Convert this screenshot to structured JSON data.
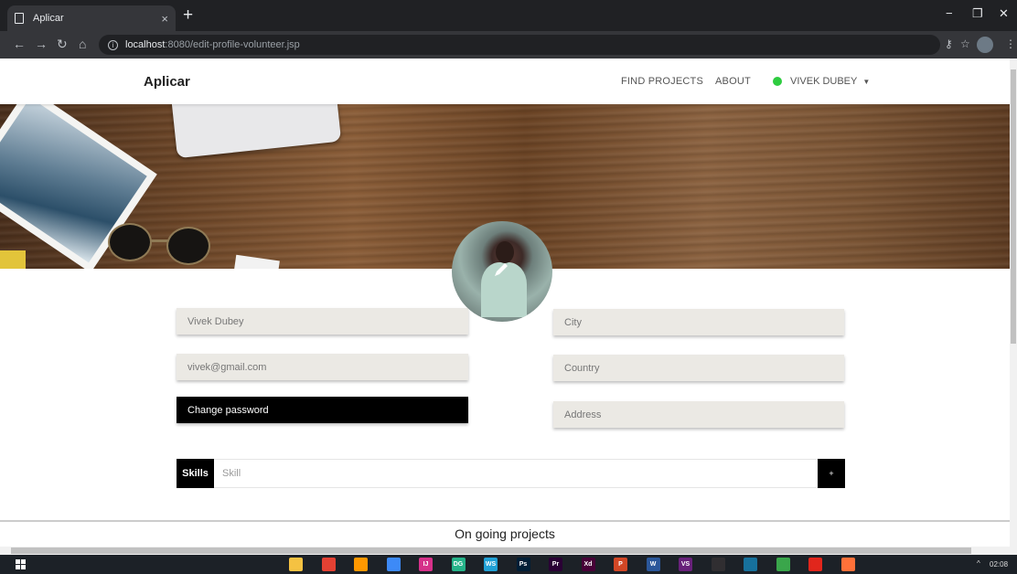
{
  "browser": {
    "tab_title": "Aplicar",
    "tab_close": "×",
    "new_tab": "+",
    "url_host": "localhost",
    "url_path": ":8080/edit-profile-volunteer.jsp",
    "win_min": "−",
    "win_max": "❐",
    "win_close": "✕"
  },
  "navbar": {
    "brand": "Aplicar",
    "links": [
      "FIND PROJECTS",
      "ABOUT"
    ],
    "user_name": "VIVEK DUBEY",
    "user_status_color": "#2ecc40"
  },
  "profile_form": {
    "name_value": "Vivek Dubey",
    "email_value": "vivek@gmail.com",
    "change_password_label": "Change password",
    "city_placeholder": "City",
    "country_placeholder": "Country",
    "address_placeholder": "Address"
  },
  "skills": {
    "label": "Skills",
    "placeholder": "Skill",
    "add_label": "+"
  },
  "sections": {
    "ongoing_title": "On going projects"
  },
  "taskbar": {
    "clock": "02:08",
    "tray": "^",
    "apps": [
      {
        "icon": "file-explorer-icon",
        "color": "#f5c242",
        "label": ""
      },
      {
        "icon": "chrome-icon",
        "color": "#e34133",
        "label": ""
      },
      {
        "icon": "sublime-icon",
        "color": "#ff9800",
        "label": ""
      },
      {
        "icon": "notes-icon",
        "color": "#3d8af7",
        "label": ""
      },
      {
        "icon": "intellij-icon",
        "color": "#d6318a",
        "label": "IJ"
      },
      {
        "icon": "datagrip-icon",
        "color": "#25b389",
        "label": "DG"
      },
      {
        "icon": "webstorm-icon",
        "color": "#21a1d6",
        "label": "WS"
      },
      {
        "icon": "photoshop-icon",
        "color": "#001e36",
        "label": "Ps"
      },
      {
        "icon": "premiere-icon",
        "color": "#2a0035",
        "label": "Pr"
      },
      {
        "icon": "xd-icon",
        "color": "#470137",
        "label": "Xd"
      },
      {
        "icon": "powerpoint-icon",
        "color": "#d24726",
        "label": "P"
      },
      {
        "icon": "word-icon",
        "color": "#2b579a",
        "label": "W"
      },
      {
        "icon": "visual-studio-icon",
        "color": "#68217a",
        "label": "VS"
      },
      {
        "icon": "obs-icon",
        "color": "#302e31",
        "label": ""
      },
      {
        "icon": "app-icon",
        "color": "#17719c",
        "label": ""
      },
      {
        "icon": "green-app-icon",
        "color": "#3aa64b",
        "label": ""
      },
      {
        "icon": "opera-icon",
        "color": "#e1261c",
        "label": ""
      },
      {
        "icon": "firefox-icon",
        "color": "#ff7139",
        "label": ""
      }
    ]
  }
}
